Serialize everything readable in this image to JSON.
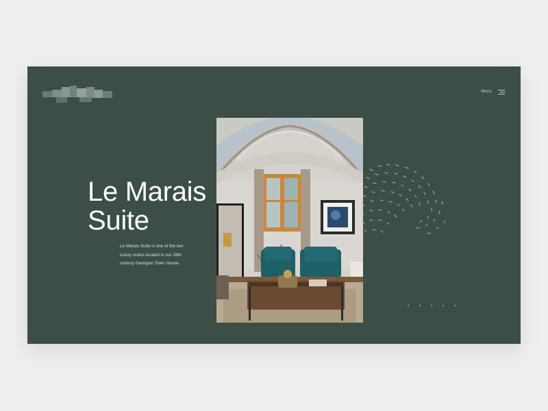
{
  "header": {
    "menu_label": "Menu",
    "logo": "blurred-logo",
    "menu_icon": "hamburger-icon"
  },
  "hero": {
    "title_line1": "Le Marais",
    "title_line2": "Suite",
    "description_line1": "Le Marais Suite is one of the two",
    "description_line2": "luxury suites located in our 18th",
    "description_line3": "century Georgian Town House."
  },
  "slider": {
    "count": 5
  },
  "colors": {
    "panel": "#3d4e47",
    "page_background": "#efefef",
    "text": "#ffffff"
  }
}
